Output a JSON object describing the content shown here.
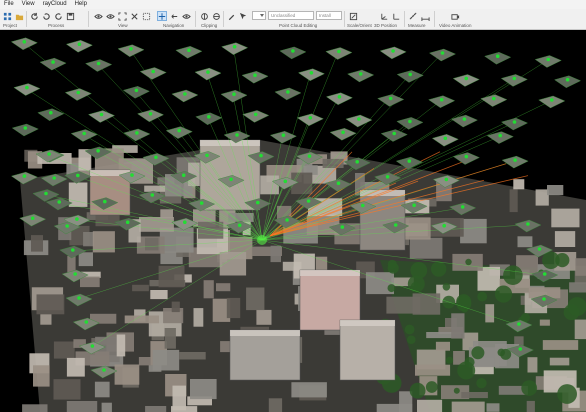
{
  "menu": {
    "items": [
      "File",
      "View",
      "rayCloud",
      "Help"
    ]
  },
  "ribbon": {
    "groups": [
      "Project",
      "Process",
      "View",
      "Navigation",
      "Clipping",
      "Point Cloud Editing",
      "Scale/Orient",
      "3D Position",
      "Measure",
      "Video Animation"
    ],
    "combo_placeholder": "Unclassified",
    "combo_value": "Install"
  },
  "icons": {
    "grid": "grid-icon",
    "open": "folder-icon",
    "save": "save-icon",
    "refresh": "refresh-icon",
    "undo": "undo-icon",
    "redo": "redo-icon",
    "fit": "fit-view-icon",
    "close": "close-icon",
    "nav": "move-icon",
    "orbit": "orbit-icon",
    "eye": "eye-icon",
    "clip": "clip-icon",
    "brush": "brush-icon",
    "select": "select-icon",
    "scale": "scale-icon",
    "axes": "axes-icon",
    "measure": "measure-icon",
    "video": "video-icon"
  },
  "viewport": {
    "background": "#000000",
    "camera_color": "#22dd33",
    "ray_color": "#55ee44",
    "ground_ray_color": "#ff7722"
  }
}
